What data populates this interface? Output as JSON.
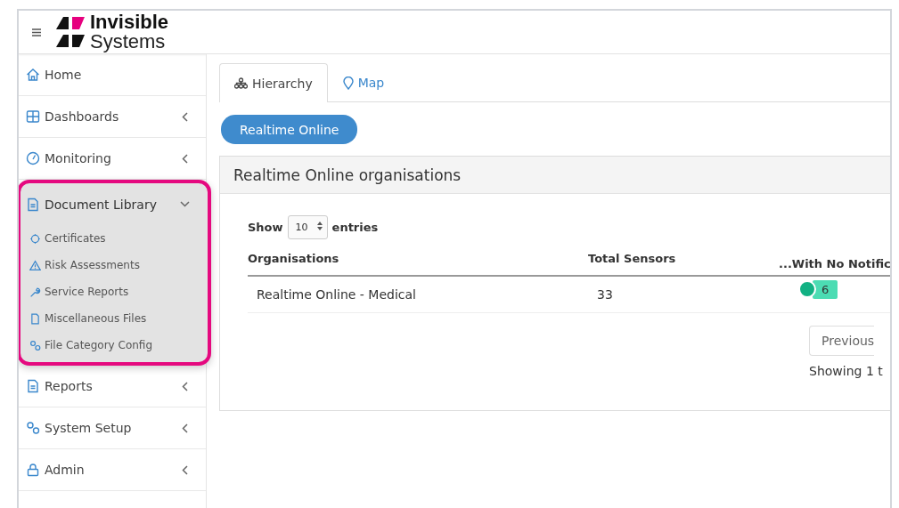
{
  "header": {
    "logo_top": "Invisible",
    "logo_bottom": "Systems"
  },
  "sidebar": {
    "items": [
      {
        "label": "Home",
        "kind": "link",
        "expanded": false,
        "highlighted": false
      },
      {
        "label": "Dashboards",
        "kind": "menu",
        "expanded": false,
        "highlighted": false
      },
      {
        "label": "Monitoring",
        "kind": "menu",
        "expanded": false,
        "highlighted": false
      },
      {
        "label": "Document Library",
        "kind": "menu",
        "expanded": true,
        "highlighted": true,
        "children": [
          {
            "label": "Certificates"
          },
          {
            "label": "Risk Assessments"
          },
          {
            "label": "Service Reports"
          },
          {
            "label": "Miscellaneous Files"
          },
          {
            "label": "File Category Config"
          }
        ]
      },
      {
        "label": "Reports",
        "kind": "menu",
        "expanded": false,
        "highlighted": false
      },
      {
        "label": "System Setup",
        "kind": "menu",
        "expanded": false,
        "highlighted": false
      },
      {
        "label": "Admin",
        "kind": "menu",
        "expanded": false,
        "highlighted": false
      }
    ]
  },
  "tabs": [
    {
      "label": "Hierarchy",
      "selected": true
    },
    {
      "label": "Map",
      "selected": false
    }
  ],
  "breadcrumb_button": "Realtime Online",
  "panel": {
    "title": "Realtime Online organisations",
    "show_label": "Show",
    "page_size": "10",
    "entries_label": "entries",
    "table": {
      "columns": [
        "Organisations",
        "Total Sensors",
        "...With No Notific"
      ],
      "rows": [
        {
          "organisation": "Realtime Online - Medical",
          "total_sensors": "33",
          "color": "#12b183",
          "no_notifications": "6"
        }
      ]
    },
    "pagination": {
      "previous": "Previous",
      "info": "Showing 1 t"
    }
  }
}
